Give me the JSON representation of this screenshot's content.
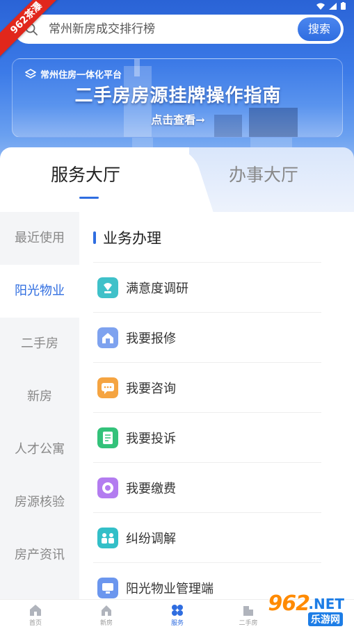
{
  "badge": {
    "label": "962茶瀑"
  },
  "search": {
    "placeholder": "常州新房成交排行榜",
    "button_label": "搜索"
  },
  "banner": {
    "logo_text": "常州住房一体化平台",
    "title": "二手房房源挂牌操作指南",
    "cta": "点击查看→"
  },
  "tabs": [
    {
      "label": "服务大厅",
      "active": true
    },
    {
      "label": "办事大厅",
      "active": false
    }
  ],
  "sidebar": {
    "items": [
      {
        "label": "最近使用",
        "active": false
      },
      {
        "label": "阳光物业",
        "active": true
      },
      {
        "label": "二手房",
        "active": false
      },
      {
        "label": "新房",
        "active": false
      },
      {
        "label": "人才公寓",
        "active": false
      },
      {
        "label": "房源核验",
        "active": false
      },
      {
        "label": "房产资讯",
        "active": false
      }
    ]
  },
  "section": {
    "title": "业务办理",
    "items": [
      {
        "label": "满意度调研",
        "icon": "rating-icon",
        "color": "#3fc1c9"
      },
      {
        "label": "我要报修",
        "icon": "repair-icon",
        "color": "#7ea2ef"
      },
      {
        "label": "我要咨询",
        "icon": "chat-icon",
        "color": "#f5a441"
      },
      {
        "label": "我要投诉",
        "icon": "complaint-icon",
        "color": "#33c27a"
      },
      {
        "label": "我要缴费",
        "icon": "payment-icon",
        "color": "#b37cf0"
      },
      {
        "label": "纠纷调解",
        "icon": "mediation-icon",
        "color": "#33bfc8"
      },
      {
        "label": "阳光物业管理端",
        "icon": "admin-icon",
        "color": "#6b96ee"
      }
    ]
  },
  "bottom_nav": {
    "items": [
      {
        "label": "首页",
        "icon": "home-icon",
        "active": false
      },
      {
        "label": "新房",
        "icon": "new-house-icon",
        "active": false
      },
      {
        "label": "服务",
        "icon": "service-icon",
        "active": true
      },
      {
        "label": "二手房",
        "icon": "second-hand-icon",
        "active": false
      }
    ]
  },
  "watermark": {
    "brand": "962",
    "suffix": ".NET",
    "sub": "乐游网"
  },
  "colors": {
    "accent": "#2f6de0",
    "sidebar_bg": "#f4f5f7"
  }
}
